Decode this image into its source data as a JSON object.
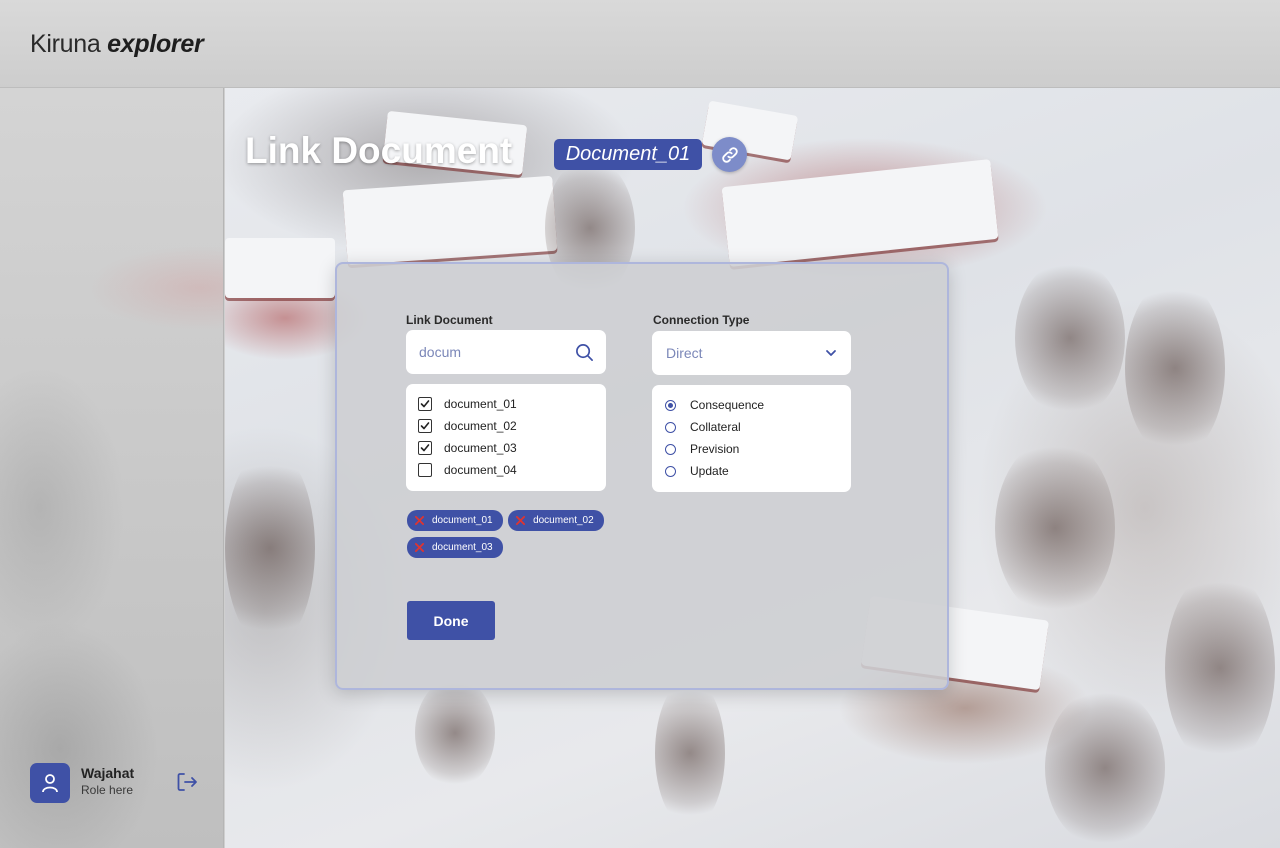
{
  "app": {
    "brand_regular": "Kiruna",
    "brand_bold": "explorer"
  },
  "user": {
    "name": "Wajahat",
    "role": "Role here"
  },
  "page": {
    "title": "Link Document",
    "current_document": "Document_01"
  },
  "form": {
    "link_label": "Link Document",
    "search_value": "docum",
    "documents": [
      {
        "label": "document_01",
        "checked": true
      },
      {
        "label": "document_02",
        "checked": true
      },
      {
        "label": "document_03",
        "checked": true
      },
      {
        "label": "document_04",
        "checked": false
      }
    ],
    "selected_tags": [
      "document_01",
      "document_02",
      "document_03"
    ],
    "connection_label": "Connection Type",
    "connection_value": "Direct",
    "connection_types": [
      {
        "label": "Consequence",
        "selected": true
      },
      {
        "label": "Collateral",
        "selected": false
      },
      {
        "label": "Prevision",
        "selected": false
      },
      {
        "label": "Update",
        "selected": false
      }
    ],
    "done_label": "Done"
  },
  "colors": {
    "accent": "#3f51a6",
    "link_button": "#7d8cc9",
    "tag_remove": "#e0342f"
  }
}
